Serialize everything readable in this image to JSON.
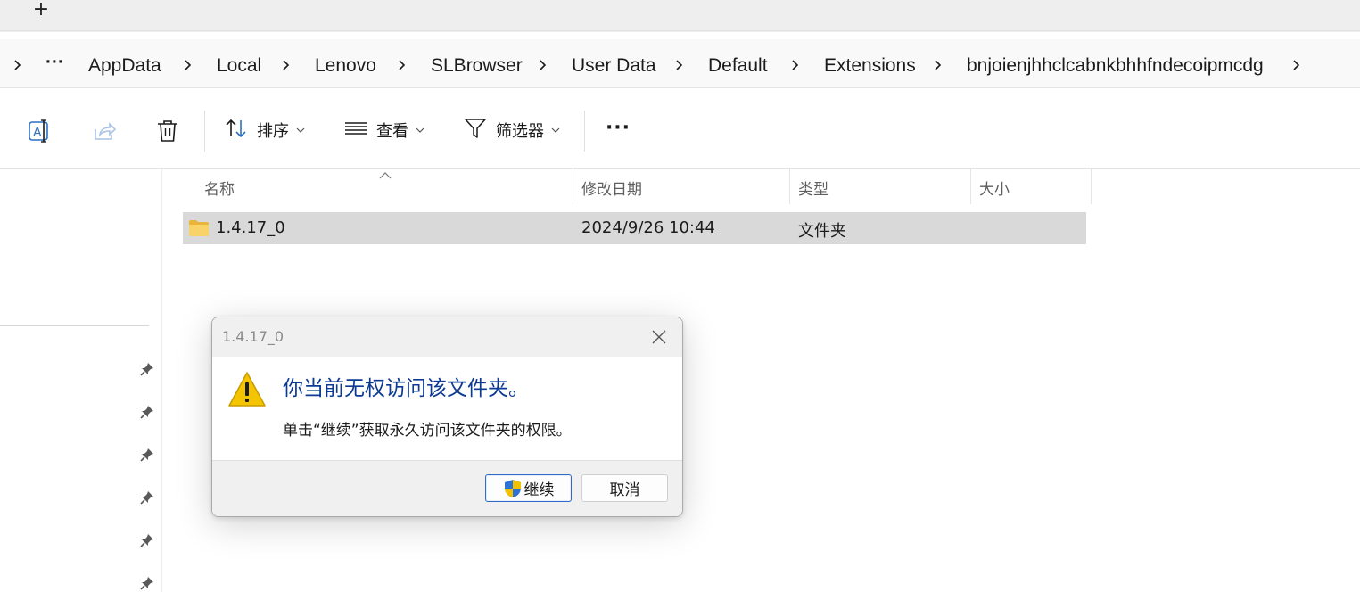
{
  "tabstrip": {
    "new_tab_glyph": "+"
  },
  "breadcrumb": {
    "overflow": "···",
    "items": [
      "AppData",
      "Local",
      "Lenovo",
      "SLBrowser",
      "User Data",
      "Default",
      "Extensions",
      "bnjoienjhhclcabnkbhhfndecoipmcdg"
    ]
  },
  "commandbar": {
    "rename_icon": "rename-icon",
    "share_icon": "share-icon",
    "delete_icon": "trash-icon",
    "sort_label": "排序",
    "view_label": "查看",
    "filter_label": "筛选器",
    "more_label": "···"
  },
  "columns": {
    "name": "名称",
    "modified": "修改日期",
    "type": "类型",
    "size": "大小"
  },
  "rows": [
    {
      "name": "1.4.17_0",
      "modified": "2024/9/26 10:44",
      "type": "文件夹",
      "size": ""
    }
  ],
  "dialog": {
    "title": "1.4.17_0",
    "heading": "你当前无权访问该文件夹。",
    "message": "单击“继续”获取永久访问该文件夹的权限。",
    "continue_label": "继续",
    "cancel_label": "取消"
  },
  "colors": {
    "heading_blue": "#0c3a93",
    "selected_row": "#d9d9d9",
    "folder_yellow": "#f7c948",
    "warning_yellow": "#f5c400",
    "primary_border": "#2e6bc6"
  }
}
